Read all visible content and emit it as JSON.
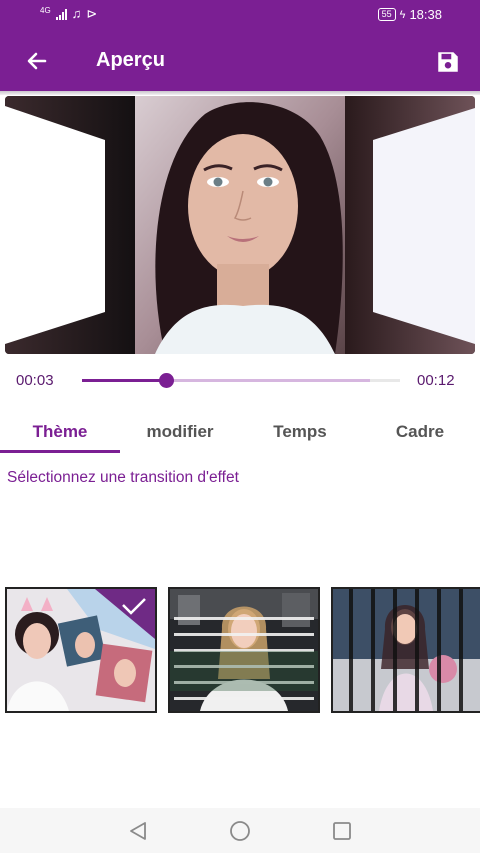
{
  "status_bar": {
    "network": "4G",
    "battery": "55",
    "time": "18:38"
  },
  "app_bar": {
    "title": "Aperçu",
    "back_icon": "arrow-left-icon",
    "save_icon": "floppy-disk-icon"
  },
  "player": {
    "current_time": "00:03",
    "total_time": "00:12",
    "progress": 0.29
  },
  "tabs": [
    {
      "label": "Thème",
      "active": true
    },
    {
      "label": "modifier",
      "active": false
    },
    {
      "label": "Temps",
      "active": false
    },
    {
      "label": "Cadre",
      "active": false
    }
  ],
  "hint": "Sélectionnez une transition d'effet",
  "themes": [
    {
      "name": "collage-theme",
      "selected": true
    },
    {
      "name": "slices-theme",
      "selected": false
    },
    {
      "name": "strips-theme",
      "selected": false
    }
  ],
  "colors": {
    "primary": "#7b1f93",
    "accent_light": "#d6b6df"
  },
  "nav": {
    "back_icon": "triangle-back-icon",
    "home_icon": "circle-home-icon",
    "recents_icon": "square-recents-icon"
  }
}
